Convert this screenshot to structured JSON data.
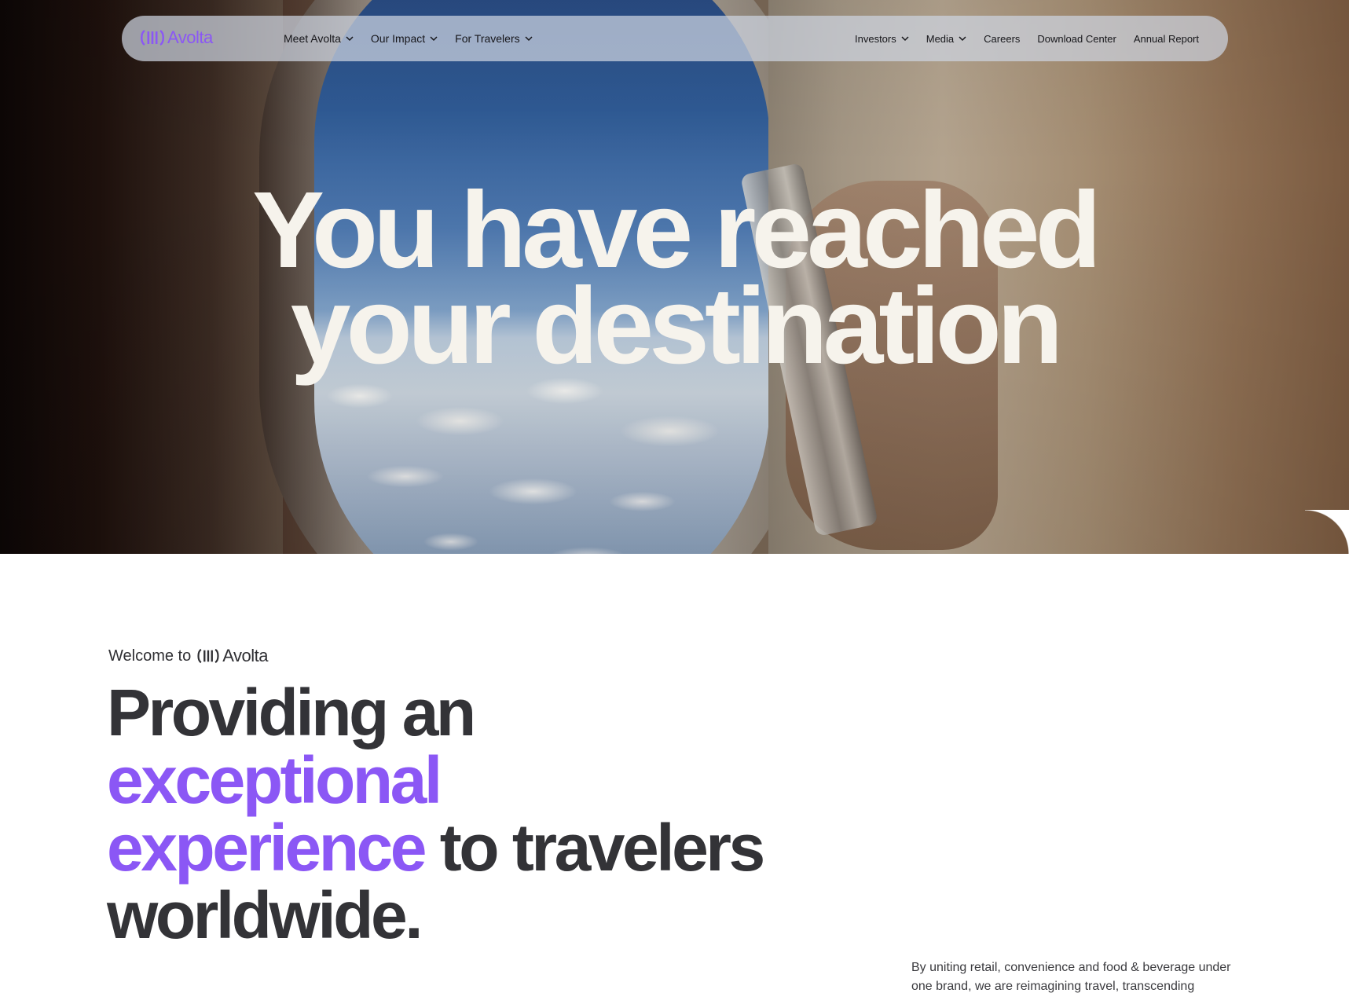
{
  "nav": {
    "logo_text": "Avolta",
    "left_items": [
      {
        "label": "Meet Avolta",
        "has_dropdown": true
      },
      {
        "label": "Our Impact",
        "has_dropdown": true
      },
      {
        "label": "For Travelers",
        "has_dropdown": true
      }
    ],
    "right_items": [
      {
        "label": "Investors",
        "has_dropdown": true
      },
      {
        "label": "Media",
        "has_dropdown": true
      },
      {
        "label": "Careers",
        "has_dropdown": false
      },
      {
        "label": "Download Center",
        "has_dropdown": false
      },
      {
        "label": "Annual Report",
        "has_dropdown": false
      }
    ]
  },
  "hero": {
    "title_line1": "You have reached",
    "title_line2": "your destination"
  },
  "welcome": {
    "prefix": "Welcome to",
    "brand": "Avolta"
  },
  "headline": {
    "part1": "Providing an",
    "accent_line1": "exceptional",
    "accent_line2": "experience",
    "part2": "to travelers",
    "part3": "worldwide."
  },
  "intro": {
    "text": "By uniting retail, convenience and food & beverage under one brand, we are reimagining travel, transcending"
  },
  "colors": {
    "accent": "#8b57f5",
    "text_dark": "#333337",
    "hero_text": "#f6f3ec"
  }
}
